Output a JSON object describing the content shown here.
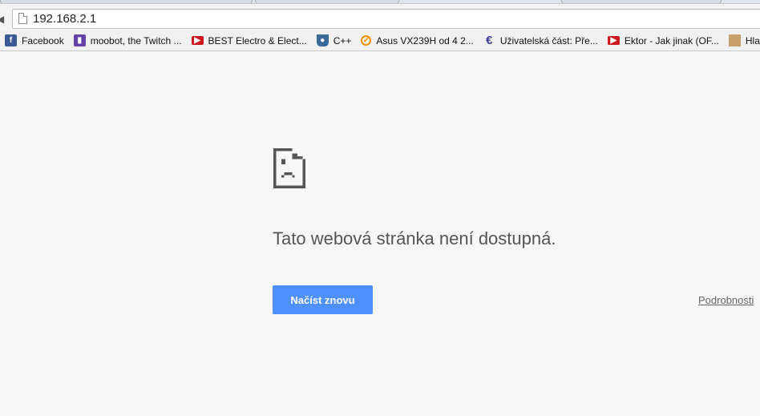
{
  "address_bar": {
    "url": "192.168.2.1"
  },
  "bookmarks": [
    {
      "label": "Facebook",
      "icon": "facebook-icon",
      "color": "#3b5998"
    },
    {
      "label": "moobot, the Twitch ...",
      "icon": "twitch-icon",
      "color": "#6441a5"
    },
    {
      "label": "BEST Electro & Elect...",
      "icon": "youtube-icon",
      "color": "#cc181e"
    },
    {
      "label": "C++",
      "icon": "bucket-icon",
      "color": "#3a6a9a"
    },
    {
      "label": "Asus VX239H od 4 2...",
      "icon": "search-q-icon",
      "color": "#f39200"
    },
    {
      "label": "Uživatelská část: Pře...",
      "icon": "euro-logo-icon",
      "color": "#3a3a9a"
    },
    {
      "label": "Ektor - Jak jinak (OF...",
      "icon": "youtube-icon",
      "color": "#cc181e"
    },
    {
      "label": "Hlavn",
      "icon": "minecraft-face-icon",
      "color": "#c7a06b"
    }
  ],
  "error": {
    "title": "Tato webová stránka není dostupná.",
    "reload_label": "Načíst znovu",
    "details_label": "Podrobnosti",
    "button_color": "#4d90fe"
  }
}
